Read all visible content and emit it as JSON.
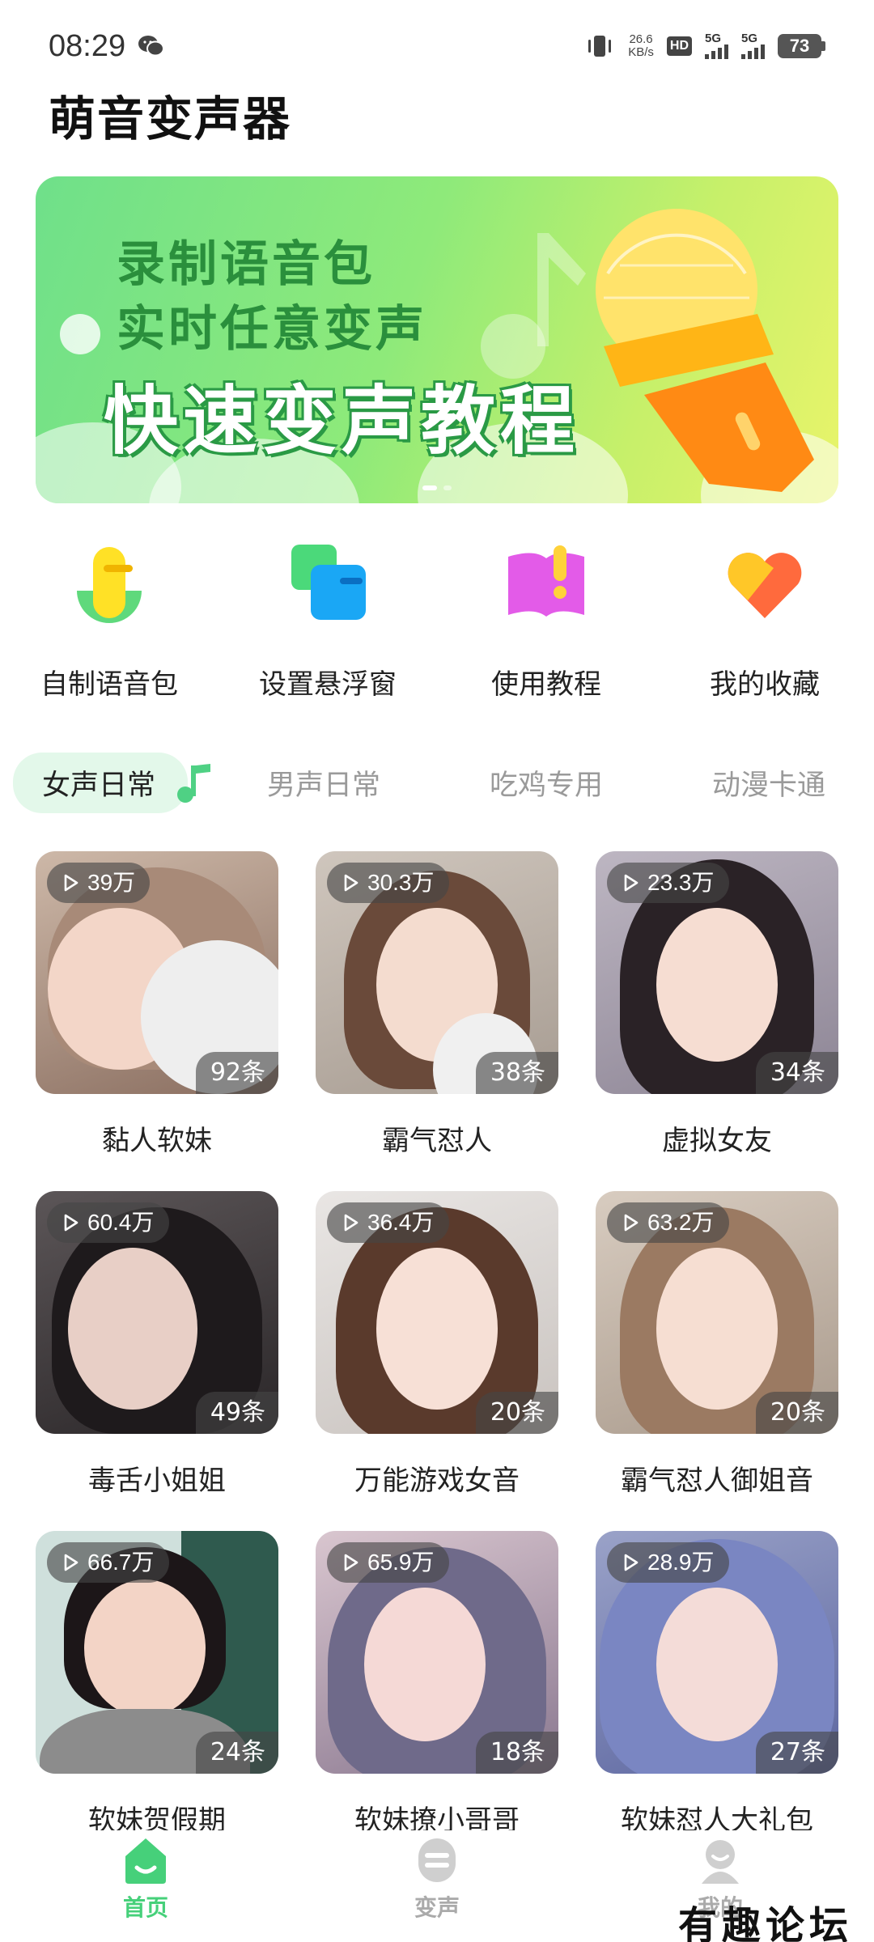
{
  "status_bar": {
    "time": "08:29",
    "net_speed_value": "26.6",
    "net_speed_unit": "KB/s",
    "hd_label": "HD",
    "sim1_label": "5G",
    "sim2_label": "5G",
    "battery": "73"
  },
  "app": {
    "title": "萌音变声器"
  },
  "banner": {
    "line1": "录制语音包",
    "line2": "实时任意变声",
    "line3": "快速变声教程",
    "page_count": 2,
    "active_page": 1
  },
  "quick_actions": [
    {
      "label": "自制语音包",
      "icon": "microphone-icon"
    },
    {
      "label": "设置悬浮窗",
      "icon": "floating-window-icon"
    },
    {
      "label": "使用教程",
      "icon": "tutorial-book-icon"
    },
    {
      "label": "我的收藏",
      "icon": "heart-icon"
    }
  ],
  "category_tabs": [
    {
      "label": "女声日常",
      "active": true
    },
    {
      "label": "男声日常",
      "active": false
    },
    {
      "label": "吃鸡专用",
      "active": false
    },
    {
      "label": "动漫卡通",
      "active": false
    }
  ],
  "voice_packs": [
    {
      "title": "黏人软妹",
      "plays": "39万",
      "count": "92条"
    },
    {
      "title": "霸气怼人",
      "plays": "30.3万",
      "count": "38条"
    },
    {
      "title": "虚拟女友",
      "plays": "23.3万",
      "count": "34条"
    },
    {
      "title": "毒舌小姐姐",
      "plays": "60.4万",
      "count": "49条"
    },
    {
      "title": "万能游戏女音",
      "plays": "36.4万",
      "count": "20条"
    },
    {
      "title": "霸气怼人御姐音",
      "plays": "63.2万",
      "count": "20条"
    },
    {
      "title": "软妹贺假期",
      "plays": "66.7万",
      "count": "24条"
    },
    {
      "title": "软妹撩小哥哥",
      "plays": "65.9万",
      "count": "18条"
    },
    {
      "title": "软妹怼人大礼包",
      "plays": "28.9万",
      "count": "27条"
    }
  ],
  "bottom_nav": [
    {
      "label": "首页",
      "active": true
    },
    {
      "label": "变声",
      "active": false
    },
    {
      "label": "我的",
      "active": false
    }
  ],
  "watermark": "有趣论坛",
  "colors": {
    "accent": "#46d07a",
    "tab_active_bg": "#e3f8ea"
  }
}
